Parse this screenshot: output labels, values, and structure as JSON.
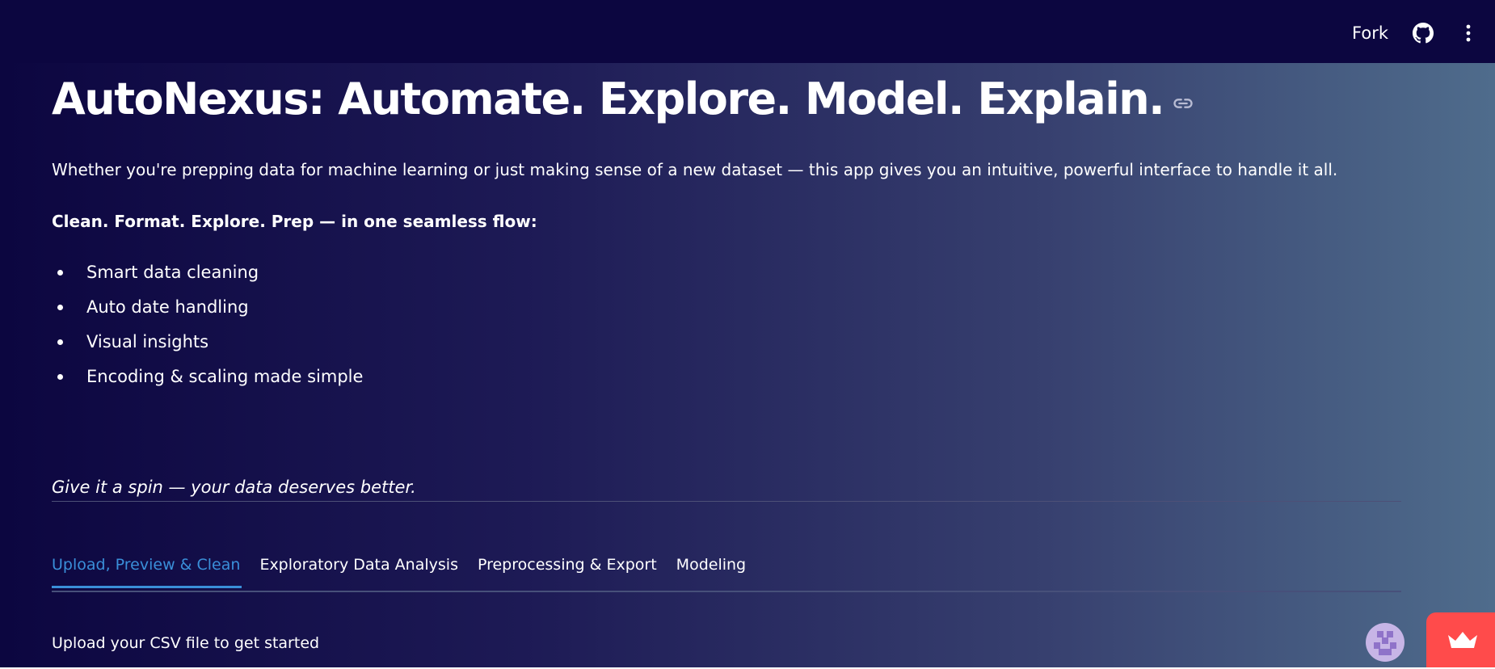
{
  "header": {
    "fork_label": "Fork",
    "github_icon": "github-icon",
    "menu_icon": "kebab-menu-icon"
  },
  "page": {
    "title": "AutoNexus: Automate. Explore. Model. Explain.",
    "anchor_icon": "link-icon",
    "intro": "Whether you're prepping data for machine learning or just making sense of a new dataset — this app gives you an intuitive, powerful interface to handle it all.",
    "subhead": "Clean. Format. Explore. Prep — in one seamless flow:",
    "features": [
      "Smart data cleaning",
      "Auto date handling",
      "Visual insights",
      "Encoding & scaling made simple"
    ],
    "tagline": "Give it a spin — your data deserves better."
  },
  "tabs": [
    {
      "label": "Upload, Preview & Clean",
      "active": true
    },
    {
      "label": "Exploratory Data Analysis",
      "active": false
    },
    {
      "label": "Preprocessing & Export",
      "active": false
    },
    {
      "label": "Modeling",
      "active": false
    }
  ],
  "upload": {
    "label": "Upload your CSV file to get started"
  },
  "floating": {
    "avatar_icon": "avatar-icon",
    "manage_app_icon": "crown-icon"
  },
  "colors": {
    "background_start": "#0c0640",
    "background_end": "#4f6c8c",
    "accent": "#3a8fd9",
    "manage_button": "#ff4b4b"
  }
}
